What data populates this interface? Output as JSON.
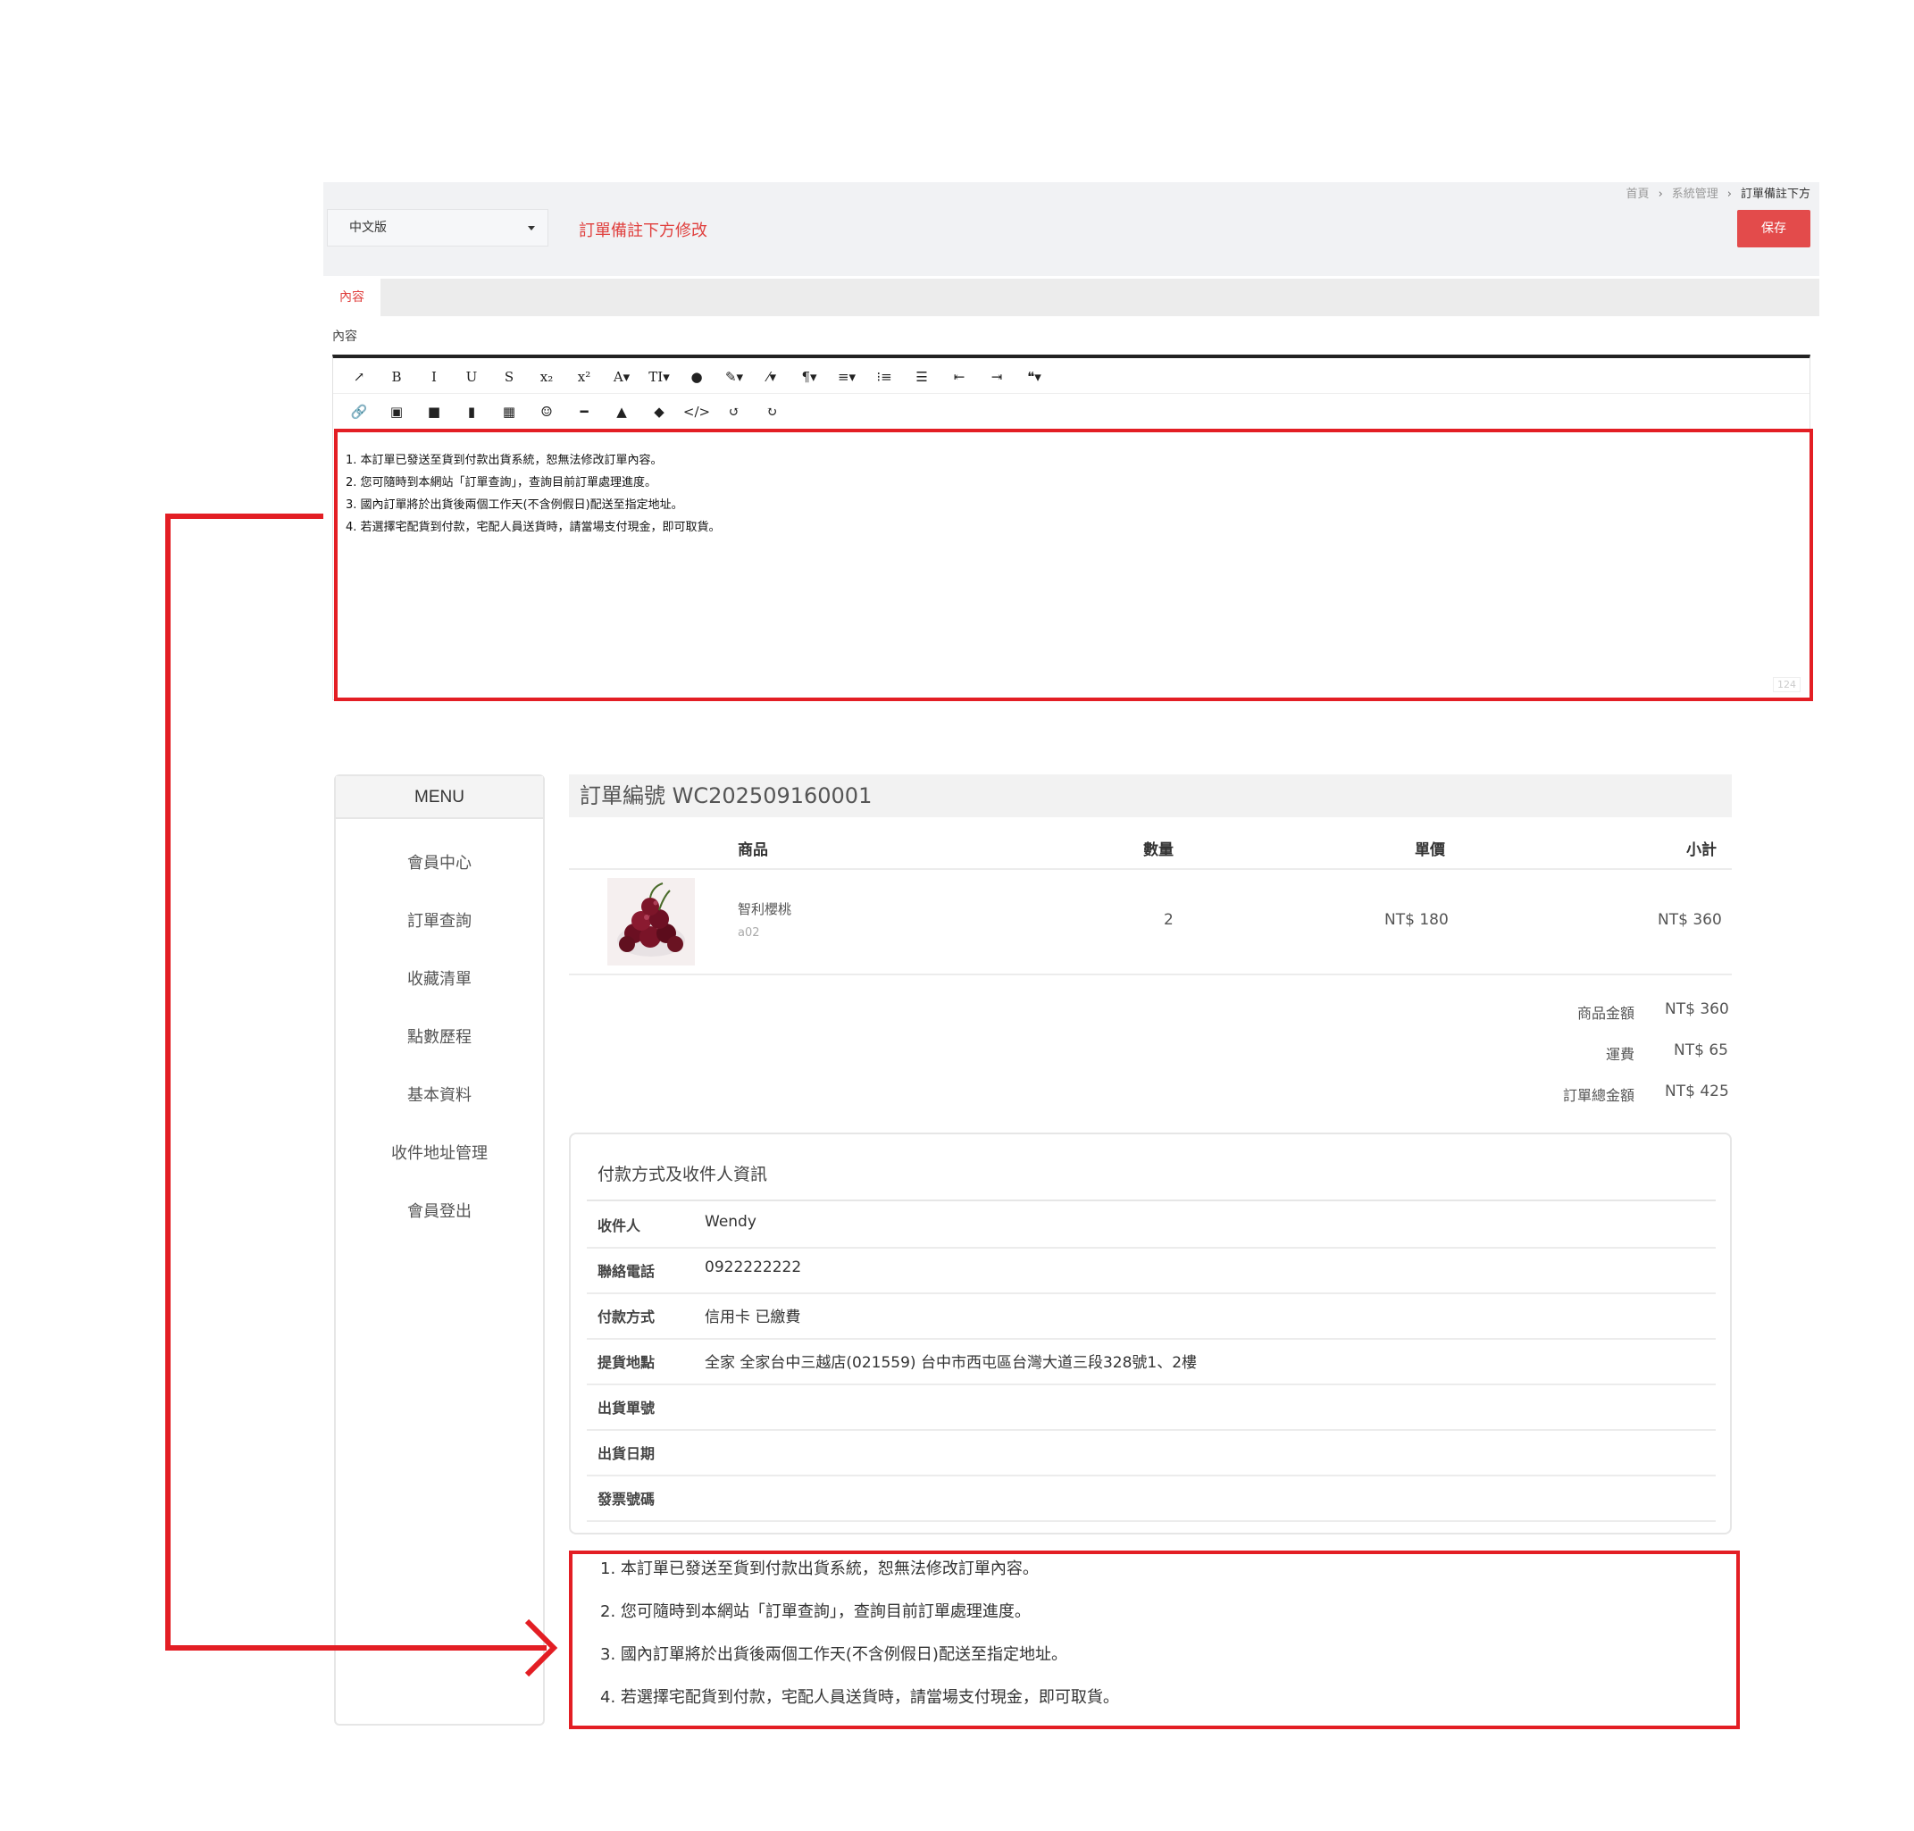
{
  "admin": {
    "breadcrumb": [
      "首頁",
      "系統管理",
      "訂單備註下方"
    ],
    "language_select": "中文版",
    "page_heading": "訂單備註下方修改",
    "save_label": "保存",
    "tab_label": "內容",
    "field_label": "內容",
    "toolbar_row1": [
      "↗",
      "B",
      "I",
      "U",
      "S",
      "x₂",
      "x²",
      "A▾",
      "TI▾",
      "●",
      "✎▾",
      "⁄▾",
      "¶▾",
      "≡▾",
      "⁝≡",
      "☰",
      "⇤",
      "⇥",
      "❝▾"
    ],
    "toolbar_row1_icons": [
      "expand-icon",
      "bold-icon",
      "italic-icon",
      "underline-icon",
      "strikethrough-icon",
      "subscript-icon",
      "superscript-icon",
      "font-color-icon",
      "font-size-icon",
      "ink-drop-icon",
      "brush-icon",
      "magic-wand-icon",
      "paragraph-icon",
      "align-icon",
      "ordered-list-icon",
      "unordered-list-icon",
      "outdent-icon",
      "indent-icon",
      "quote-icon"
    ],
    "toolbar_row2": [
      "🔗",
      "▣",
      "■",
      "▮",
      "▦",
      "☺",
      "━",
      "▲",
      "◆",
      "</>",
      "↺",
      "↻"
    ],
    "toolbar_row2_icons": [
      "link-icon",
      "image-icon",
      "video-icon",
      "file-icon",
      "table-icon",
      "emoji-icon",
      "horizontal-rule-icon",
      "select-icon",
      "eraser-icon",
      "code-view-icon",
      "undo-icon",
      "redo-icon"
    ],
    "editor_lines": [
      "1. 本訂單已發送至貨到付款出貨系統，恕無法修改訂單內容。",
      "2. 您可隨時到本網站「訂單查詢」，查詢目前訂單處理進度。",
      "3. 國內訂單將於出貨後兩個工作天(不含例假日)配送至指定地址。",
      "4. 若選擇宅配貨到付款，宅配人員送貨時，請當場支付現金，即可取貨。"
    ],
    "char_count": "124"
  },
  "menu": {
    "header": "MENU",
    "items": [
      "會員中心",
      "訂單查詢",
      "收藏清單",
      "點數歷程",
      "基本資料",
      "收件地址管理",
      "會員登出"
    ]
  },
  "order": {
    "title": "訂單編號 WC202509160001",
    "columns": [
      "商品",
      "數量",
      "單價",
      "小計"
    ],
    "item": {
      "name": "智利櫻桃",
      "sku": "a02",
      "qty": "2",
      "unit_price": "NT$ 180",
      "subtotal": "NT$ 360"
    },
    "summary": [
      {
        "label": "商品金額",
        "value": "NT$ 360"
      },
      {
        "label": "運費",
        "value": "NT$ 65"
      },
      {
        "label": "訂單總金額",
        "value": "NT$ 425"
      }
    ]
  },
  "info": {
    "title": "付款方式及收件人資訊",
    "rows": [
      {
        "label": "收件人",
        "value": "Wendy"
      },
      {
        "label": "聯絡電話",
        "value": "0922222222"
      },
      {
        "label": "付款方式",
        "value": "信用卡 已繳費"
      },
      {
        "label": "提貨地點",
        "value": "全家 全家台中三越店(021559) 台中市西屯區台灣大道三段328號1、2樓"
      },
      {
        "label": "出貨單號",
        "value": ""
      },
      {
        "label": "出貨日期",
        "value": ""
      },
      {
        "label": "發票號碼",
        "value": ""
      }
    ]
  },
  "notes": [
    "1. 本訂單已發送至貨到付款出貨系統，恕無法修改訂單內容。",
    "2. 您可隨時到本網站「訂單查詢」，查詢目前訂單處理進度。",
    "3. 國內訂單將於出貨後兩個工作天(不含例假日)配送至指定地址。",
    "4. 若選擇宅配貨到付款，宅配人員送貨時，請當場支付現金，即可取貨。"
  ],
  "colors": {
    "accent_red": "#e0403e",
    "save_button": "#e34b4b",
    "annotation_red": "#e31e24"
  }
}
